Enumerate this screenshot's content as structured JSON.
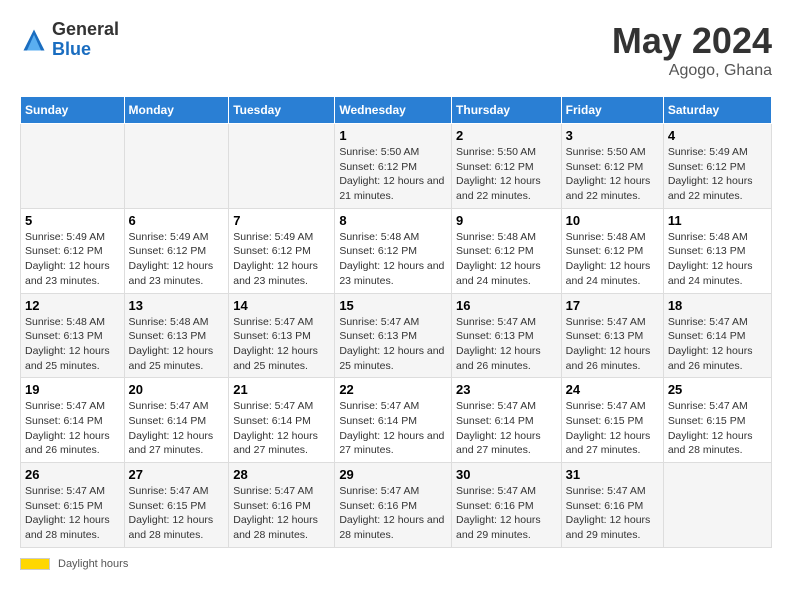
{
  "header": {
    "logo_general": "General",
    "logo_blue": "Blue",
    "main_title": "May 2024",
    "subtitle": "Agogo, Ghana"
  },
  "days_of_week": [
    "Sunday",
    "Monday",
    "Tuesday",
    "Wednesday",
    "Thursday",
    "Friday",
    "Saturday"
  ],
  "footer": {
    "bar_label": "Daylight hours"
  },
  "weeks": [
    [
      {
        "day": "",
        "sunrise": "",
        "sunset": "",
        "daylight": ""
      },
      {
        "day": "",
        "sunrise": "",
        "sunset": "",
        "daylight": ""
      },
      {
        "day": "",
        "sunrise": "",
        "sunset": "",
        "daylight": ""
      },
      {
        "day": "1",
        "sunrise": "Sunrise: 5:50 AM",
        "sunset": "Sunset: 6:12 PM",
        "daylight": "Daylight: 12 hours and 21 minutes."
      },
      {
        "day": "2",
        "sunrise": "Sunrise: 5:50 AM",
        "sunset": "Sunset: 6:12 PM",
        "daylight": "Daylight: 12 hours and 22 minutes."
      },
      {
        "day": "3",
        "sunrise": "Sunrise: 5:50 AM",
        "sunset": "Sunset: 6:12 PM",
        "daylight": "Daylight: 12 hours and 22 minutes."
      },
      {
        "day": "4",
        "sunrise": "Sunrise: 5:49 AM",
        "sunset": "Sunset: 6:12 PM",
        "daylight": "Daylight: 12 hours and 22 minutes."
      }
    ],
    [
      {
        "day": "5",
        "sunrise": "Sunrise: 5:49 AM",
        "sunset": "Sunset: 6:12 PM",
        "daylight": "Daylight: 12 hours and 23 minutes."
      },
      {
        "day": "6",
        "sunrise": "Sunrise: 5:49 AM",
        "sunset": "Sunset: 6:12 PM",
        "daylight": "Daylight: 12 hours and 23 minutes."
      },
      {
        "day": "7",
        "sunrise": "Sunrise: 5:49 AM",
        "sunset": "Sunset: 6:12 PM",
        "daylight": "Daylight: 12 hours and 23 minutes."
      },
      {
        "day": "8",
        "sunrise": "Sunrise: 5:48 AM",
        "sunset": "Sunset: 6:12 PM",
        "daylight": "Daylight: 12 hours and 23 minutes."
      },
      {
        "day": "9",
        "sunrise": "Sunrise: 5:48 AM",
        "sunset": "Sunset: 6:12 PM",
        "daylight": "Daylight: 12 hours and 24 minutes."
      },
      {
        "day": "10",
        "sunrise": "Sunrise: 5:48 AM",
        "sunset": "Sunset: 6:12 PM",
        "daylight": "Daylight: 12 hours and 24 minutes."
      },
      {
        "day": "11",
        "sunrise": "Sunrise: 5:48 AM",
        "sunset": "Sunset: 6:13 PM",
        "daylight": "Daylight: 12 hours and 24 minutes."
      }
    ],
    [
      {
        "day": "12",
        "sunrise": "Sunrise: 5:48 AM",
        "sunset": "Sunset: 6:13 PM",
        "daylight": "Daylight: 12 hours and 25 minutes."
      },
      {
        "day": "13",
        "sunrise": "Sunrise: 5:48 AM",
        "sunset": "Sunset: 6:13 PM",
        "daylight": "Daylight: 12 hours and 25 minutes."
      },
      {
        "day": "14",
        "sunrise": "Sunrise: 5:47 AM",
        "sunset": "Sunset: 6:13 PM",
        "daylight": "Daylight: 12 hours and 25 minutes."
      },
      {
        "day": "15",
        "sunrise": "Sunrise: 5:47 AM",
        "sunset": "Sunset: 6:13 PM",
        "daylight": "Daylight: 12 hours and 25 minutes."
      },
      {
        "day": "16",
        "sunrise": "Sunrise: 5:47 AM",
        "sunset": "Sunset: 6:13 PM",
        "daylight": "Daylight: 12 hours and 26 minutes."
      },
      {
        "day": "17",
        "sunrise": "Sunrise: 5:47 AM",
        "sunset": "Sunset: 6:13 PM",
        "daylight": "Daylight: 12 hours and 26 minutes."
      },
      {
        "day": "18",
        "sunrise": "Sunrise: 5:47 AM",
        "sunset": "Sunset: 6:14 PM",
        "daylight": "Daylight: 12 hours and 26 minutes."
      }
    ],
    [
      {
        "day": "19",
        "sunrise": "Sunrise: 5:47 AM",
        "sunset": "Sunset: 6:14 PM",
        "daylight": "Daylight: 12 hours and 26 minutes."
      },
      {
        "day": "20",
        "sunrise": "Sunrise: 5:47 AM",
        "sunset": "Sunset: 6:14 PM",
        "daylight": "Daylight: 12 hours and 27 minutes."
      },
      {
        "day": "21",
        "sunrise": "Sunrise: 5:47 AM",
        "sunset": "Sunset: 6:14 PM",
        "daylight": "Daylight: 12 hours and 27 minutes."
      },
      {
        "day": "22",
        "sunrise": "Sunrise: 5:47 AM",
        "sunset": "Sunset: 6:14 PM",
        "daylight": "Daylight: 12 hours and 27 minutes."
      },
      {
        "day": "23",
        "sunrise": "Sunrise: 5:47 AM",
        "sunset": "Sunset: 6:14 PM",
        "daylight": "Daylight: 12 hours and 27 minutes."
      },
      {
        "day": "24",
        "sunrise": "Sunrise: 5:47 AM",
        "sunset": "Sunset: 6:15 PM",
        "daylight": "Daylight: 12 hours and 27 minutes."
      },
      {
        "day": "25",
        "sunrise": "Sunrise: 5:47 AM",
        "sunset": "Sunset: 6:15 PM",
        "daylight": "Daylight: 12 hours and 28 minutes."
      }
    ],
    [
      {
        "day": "26",
        "sunrise": "Sunrise: 5:47 AM",
        "sunset": "Sunset: 6:15 PM",
        "daylight": "Daylight: 12 hours and 28 minutes."
      },
      {
        "day": "27",
        "sunrise": "Sunrise: 5:47 AM",
        "sunset": "Sunset: 6:15 PM",
        "daylight": "Daylight: 12 hours and 28 minutes."
      },
      {
        "day": "28",
        "sunrise": "Sunrise: 5:47 AM",
        "sunset": "Sunset: 6:16 PM",
        "daylight": "Daylight: 12 hours and 28 minutes."
      },
      {
        "day": "29",
        "sunrise": "Sunrise: 5:47 AM",
        "sunset": "Sunset: 6:16 PM",
        "daylight": "Daylight: 12 hours and 28 minutes."
      },
      {
        "day": "30",
        "sunrise": "Sunrise: 5:47 AM",
        "sunset": "Sunset: 6:16 PM",
        "daylight": "Daylight: 12 hours and 29 minutes."
      },
      {
        "day": "31",
        "sunrise": "Sunrise: 5:47 AM",
        "sunset": "Sunset: 6:16 PM",
        "daylight": "Daylight: 12 hours and 29 minutes."
      },
      {
        "day": "",
        "sunrise": "",
        "sunset": "",
        "daylight": ""
      }
    ]
  ]
}
